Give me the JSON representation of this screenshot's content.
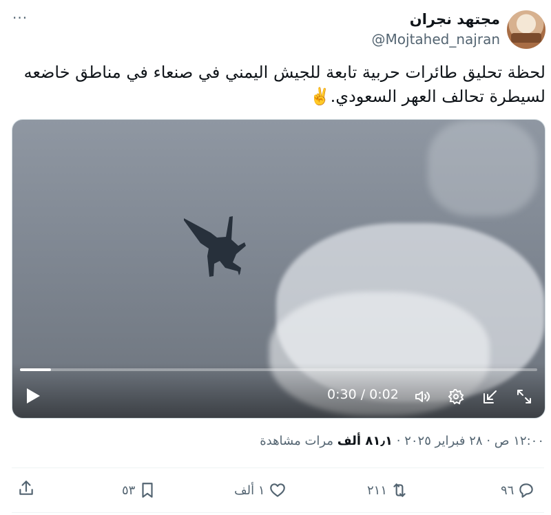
{
  "header": {
    "display_name": "مجتهد نجران",
    "handle": "@Mojtahed_najran",
    "more_label": "···"
  },
  "tweet": {
    "text": "لحظة تحليق طائرات حربية تابعة للجيش اليمني في صنعاء في مناطق خاضعه لسيطرة تحالف العهر السعودي.✌️"
  },
  "video": {
    "progress": 0.06,
    "time_label": "0:30 / 0:02",
    "icons": [
      "play-icon",
      "volume-icon",
      "settings-icon",
      "minimize-icon",
      "fullscreen-icon"
    ]
  },
  "meta": {
    "datetime": "١٢:٠٠ ص · ٢٨ فبراير ٢٠٢٥ · ",
    "views_count": "٨١٫١ ألف",
    "views_label": " مرات مشاهدة"
  },
  "actions": {
    "replies": "٩٦",
    "reposts": "٢١١",
    "likes": "١ ألف",
    "bookmarks": "٥٣"
  },
  "colors": {
    "text": "#0f1419",
    "secondary": "#536471",
    "border": "#cfd9de"
  }
}
